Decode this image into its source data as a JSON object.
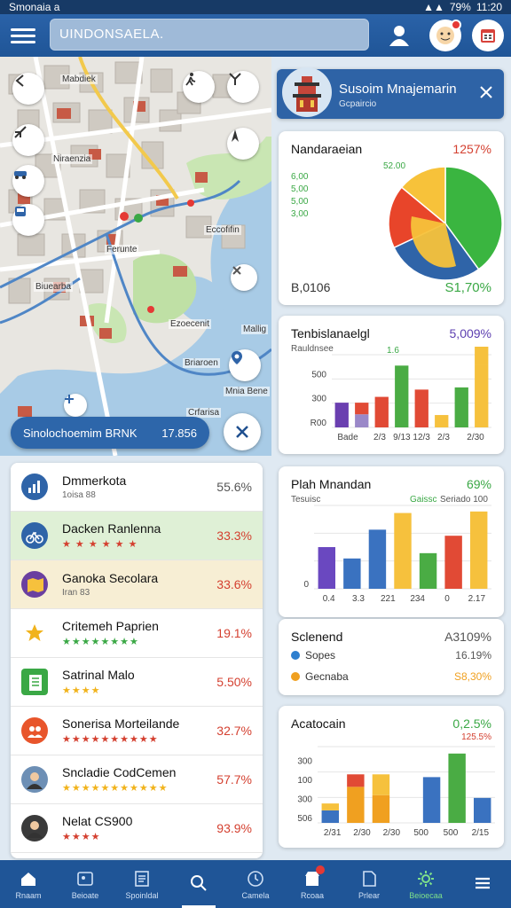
{
  "status_bar": {
    "left": "Smonaia  a",
    "right": "11:20",
    "battery": "79%"
  },
  "app_bar": {
    "search_text": "UINDONSAELA."
  },
  "map": {
    "labels": [
      "Mabdiek",
      "Niraenzia",
      "Ferunte",
      "Biuearba",
      "Eccofifin",
      "Ezoecenit",
      "Briaroen",
      "Mallig",
      "Crfarisa",
      "Mnia Bene"
    ],
    "route": {
      "label": "Sinolochoemim BRNK",
      "value": "17.856"
    }
  },
  "destination": {
    "title": "Susoim Mnajemarin",
    "subtitle": "Gcpaircio"
  },
  "list": [
    {
      "title": "Dmmerkota",
      "sub": "1oisa 88",
      "value": "55.6%",
      "color": "#555555",
      "bg": "#ffffff",
      "icon": "chart-icon",
      "icon_color": "#2f64a8",
      "stars": ""
    },
    {
      "title": "Dacken Ranlenna",
      "sub": "",
      "value": "33.3%",
      "color": "#d44030",
      "bg": "#dff0d6",
      "icon": "bicycle-icon",
      "icon_color": "#2f64a8",
      "stars": "★ ★ ★ ★ ★ ★"
    },
    {
      "title": "Ganoka Secolara",
      "sub": "Iran 83",
      "value": "33.6%",
      "color": "#d44030",
      "bg": "#f7eed4",
      "icon": "map-icon",
      "icon_color": "#6a3fa0",
      "stars": ""
    },
    {
      "title": "Critemeh Paprien",
      "sub": "",
      "value": "19.1%",
      "color": "#d44030",
      "bg": "#ffffff",
      "icon": "star-icon",
      "icon_color": "#f1b31c",
      "stars": "★★★★★★★★"
    },
    {
      "title": "Satrinal Malo",
      "sub": "",
      "value": "5.50%",
      "color": "#d44030",
      "bg": "#ffffff",
      "icon": "book-icon",
      "icon_color": "#3aa845",
      "stars": "★★★★"
    },
    {
      "title": "Sonerisa Morteilande",
      "sub": "",
      "value": "32.7%",
      "color": "#d44030",
      "bg": "#ffffff",
      "icon": "people-icon",
      "icon_color": "#e8552b",
      "stars": "★★★★★★★★★★"
    },
    {
      "title": "Sncladie CodCemen",
      "sub": "",
      "value": "57.7%",
      "color": "#d44030",
      "bg": "#ffffff",
      "icon": "avatar-icon",
      "icon_color": "#6d8fb5",
      "stars": "★★★★★★★★★★★"
    },
    {
      "title": "Nelat CS900",
      "sub": "",
      "value": "93.9%",
      "color": "#d44030",
      "bg": "#ffffff",
      "icon": "avatar-icon",
      "icon_color": "#3a3a3a",
      "stars": "★★★★"
    }
  ],
  "cards": {
    "pie": {
      "title": "Nandaraeian",
      "value": "1257%",
      "footer_left": "B,0106",
      "footer_right": "S1,70%",
      "legend": [
        "6,00",
        "5,00",
        "5,00",
        "3,00"
      ],
      "segment_labels": [
        "5,0",
        "52.00"
      ]
    },
    "bar1": {
      "title": "Tenbislanaelgl",
      "value": "5,009%",
      "yticks": [
        "R00",
        "300",
        "500"
      ],
      "xticks": [
        "Bade",
        "2/3",
        "9/13 12/3",
        "2/3",
        "2/30"
      ],
      "top_label": "Rauldnsee",
      "value_label": "1.6"
    },
    "bar2": {
      "title": "Plah Mnandan",
      "value": "69%",
      "sub_left": "Tesuisc",
      "sub_right": "Seriado 100",
      "extra": "Gaissc",
      "yticks": [
        "0"
      ],
      "xticks": [
        "0.4",
        "3.3",
        "221",
        "234",
        "0",
        "2.17"
      ]
    },
    "legend_card": {
      "title": "Sclenend",
      "value": "A3109%",
      "items": [
        {
          "label": "Sopes",
          "value": "16.19%",
          "color": "#2e7fcf"
        },
        {
          "label": "Gecnaba",
          "value": "S8,30%",
          "color": "#f0a020"
        }
      ]
    },
    "bar3": {
      "title": "Acatocain",
      "value": "0,2.5%",
      "sub": "125.5%",
      "yticks": [
        "506",
        "300",
        "100",
        "300"
      ],
      "xticks": [
        "2/31",
        "2/30",
        "2/30",
        "500",
        "500",
        "2/15"
      ]
    }
  },
  "chart_data": [
    {
      "type": "pie",
      "values": [
        40,
        28,
        18,
        14
      ],
      "colors": [
        "#3ab540",
        "#2f64a8",
        "#e8452a",
        "#f7c23a"
      ]
    },
    {
      "type": "bar",
      "categories": [
        "a",
        "b",
        "c",
        "d",
        "e",
        "f",
        "g",
        "h"
      ],
      "values": [
        34,
        18,
        42,
        85,
        52,
        17,
        55,
        86
      ],
      "colors": [
        "#6a3fb0",
        "#9a88c8",
        "#e14a35",
        "#4aac44",
        "#e14a35",
        "#f6c13d",
        "#4aac44",
        "#f6c13d"
      ],
      "secondary": [
        0,
        16,
        0,
        0,
        0,
        0,
        0,
        25
      ],
      "ylim": [
        0,
        100
      ]
    },
    {
      "type": "bar",
      "categories": [
        "a",
        "b",
        "c",
        "d",
        "e",
        "f",
        "g"
      ],
      "values": [
        55,
        40,
        78,
        100,
        47,
        70,
        102
      ],
      "colors": [
        "#6a48c0",
        "#3a72c0",
        "#3a72c0",
        "#f6c13d",
        "#4aac44",
        "#e14a35",
        "#f6c13d"
      ],
      "ylim": [
        0,
        110
      ]
    },
    {
      "type": "bar",
      "categories": [
        "a",
        "b",
        "c",
        "d",
        "e",
        "f",
        "g"
      ],
      "values": [
        18,
        52,
        40,
        0,
        66,
        100,
        36
      ],
      "colors": [
        "#3a72c0",
        "#f0a020",
        "#f0a020",
        "#3a72c0",
        "#3a72c0",
        "#4aac44",
        "#3a72c0"
      ],
      "secondary": [
        10,
        18,
        30,
        0,
        0,
        0,
        0
      ],
      "ylim": [
        0,
        110
      ]
    }
  ],
  "bottom_nav": [
    {
      "label": "Rnaam",
      "icon": "home-icon"
    },
    {
      "label": "Beioate",
      "icon": "image-icon"
    },
    {
      "label": "Spoinldal",
      "icon": "document-icon"
    },
    {
      "label": "",
      "icon": "search-icon"
    },
    {
      "label": "Camela",
      "icon": "clock-icon"
    },
    {
      "label": "Rcoaa",
      "icon": "shop-icon"
    },
    {
      "label": "Prlear",
      "icon": "file-icon"
    },
    {
      "label": "Beioecaa",
      "icon": "settings-icon"
    },
    {
      "label": "",
      "icon": "menu-icon"
    }
  ]
}
